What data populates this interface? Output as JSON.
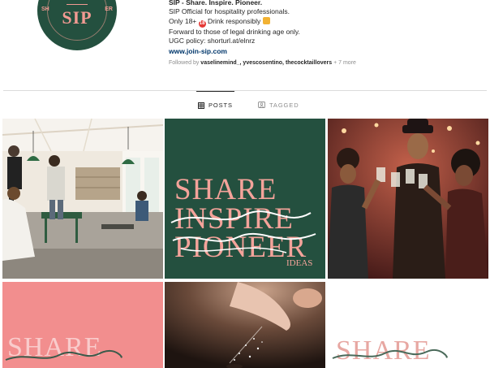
{
  "profile": {
    "avatar_letters": "SIP",
    "avatar_side_left": "SH",
    "avatar_side_right": "ER",
    "title": "SIP - Share. Inspire. Pioneer.",
    "bio_line_1": "SIP Official for hospitality professionals.",
    "bio_line_2_a": "Only 18+",
    "bio_line_2_emoji": "18",
    "bio_line_2_b": " Drink responsibly",
    "bio_line_3": "Forward to those of legal drinking age only.",
    "bio_line_4": "UGC policy: shorturl.at/elnrz",
    "website": "www.join-sip.com",
    "followed_prefix": "Followed by ",
    "followed_names": "vaselinemind_, yvescosentino, thecocktaillovers",
    "followed_more": " + 7 more"
  },
  "tabs": {
    "posts": "POSTS",
    "tagged": "TAGGED"
  },
  "posts": {
    "green": {
      "word1": "SHARE",
      "word2": "INSPIRE",
      "word3": "PIONEER",
      "word4": "IDEAS"
    },
    "pink": {
      "word": "SHARE"
    },
    "white": {
      "word": "SHARE"
    }
  },
  "colors": {
    "brand_green": "#24503f",
    "brand_pink": "#f29a92",
    "link_blue": "#00376b"
  }
}
